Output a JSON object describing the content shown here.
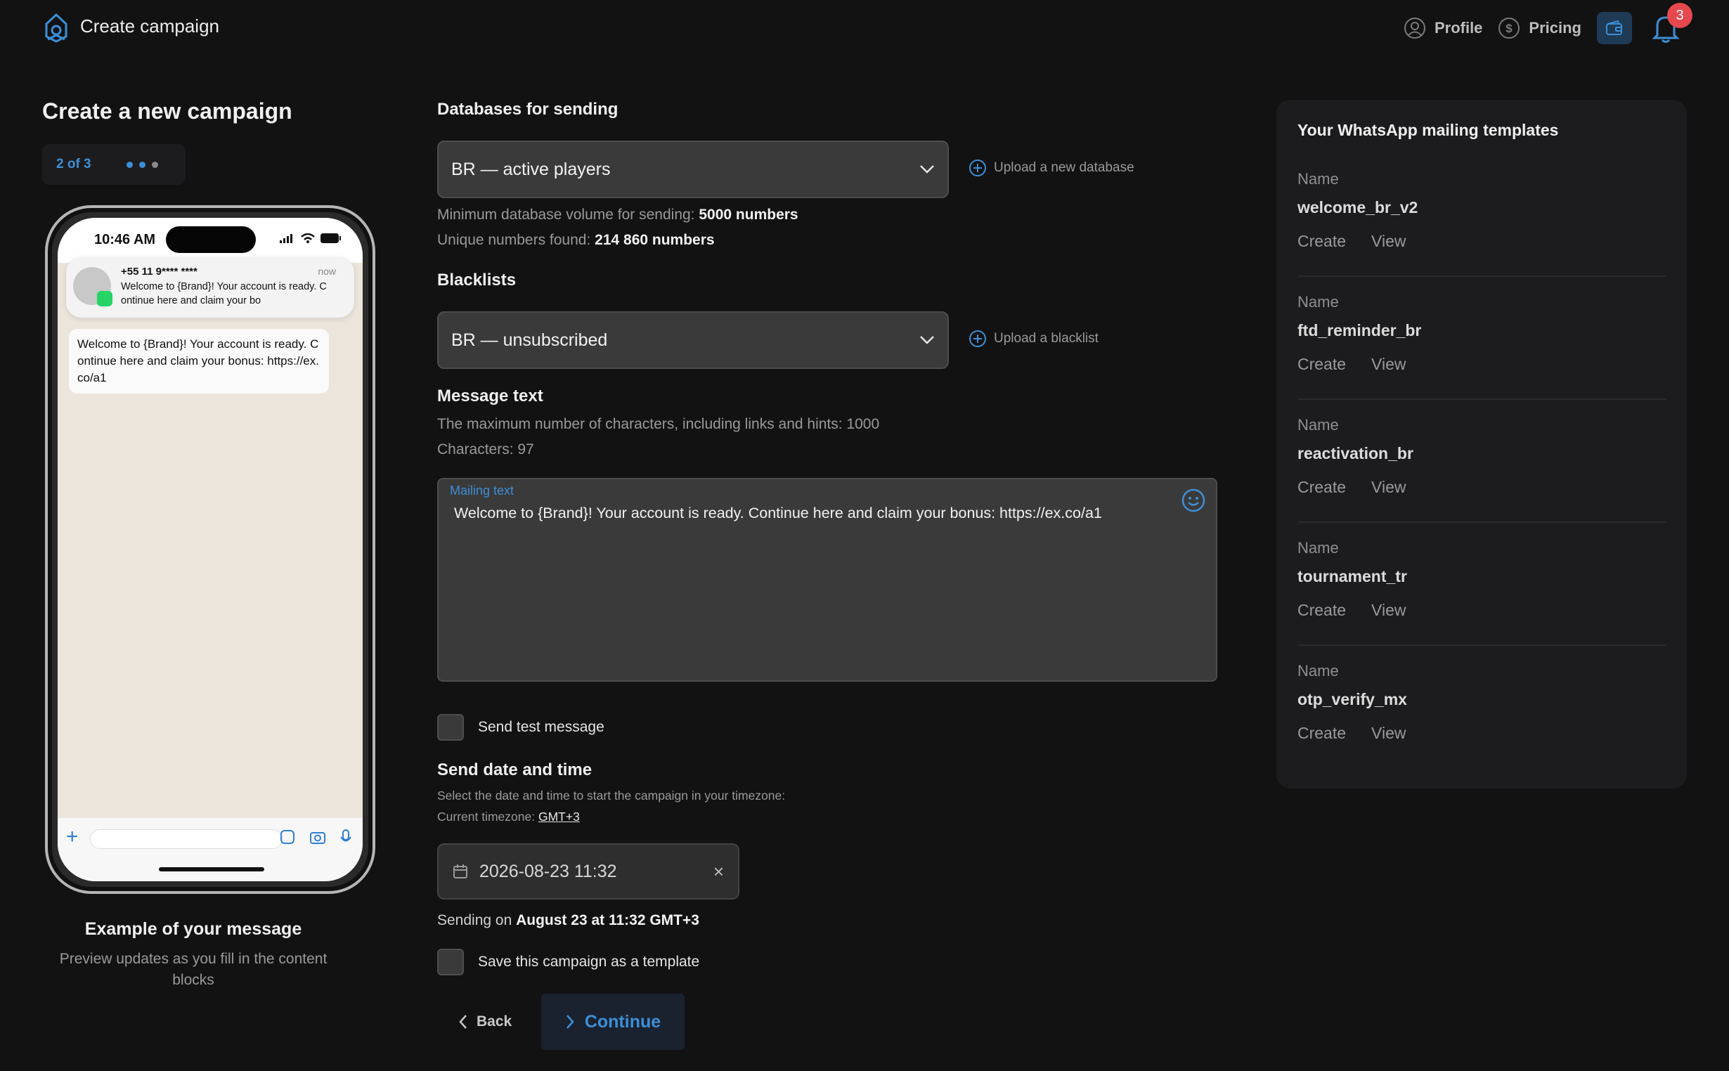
{
  "header": {
    "title": "Create campaign",
    "nav": {
      "profile": "Profile",
      "pricing": "Pricing"
    },
    "notifications_count": "3",
    "accent_color": "#3d8fd6"
  },
  "left": {
    "page_title": "Create a new campaign",
    "step": "2 of 3",
    "phone": {
      "time": "10:46 AM",
      "notification": {
        "sender": "+55 11 9**** ****",
        "time": "now",
        "body": "Welcome to {Brand}! Your account is ready. Continue here and claim your bo"
      },
      "bubble": "Welcome to {Brand}! Your account is ready. Continue here and claim your bonus: https://ex.co/a1"
    },
    "example_title": "Example of your message",
    "example_sub": "Preview updates as you fill in the content blocks"
  },
  "main": {
    "databases": {
      "title": "Databases for sending",
      "selected": "BR — active players",
      "upload_label": "Upload a new database",
      "min_volume_label": "Minimum database volume for sending:",
      "min_volume_value": "5000 numbers",
      "unique_label": "Unique numbers found:",
      "unique_value": "214 860 numbers"
    },
    "blacklists": {
      "title": "Blacklists",
      "selected": "BR — unsubscribed",
      "upload_label": "Upload a blacklist"
    },
    "message": {
      "title": "Message text",
      "max_info": "The maximum number of characters, including links and hints: 1000",
      "characters": "Characters: 97",
      "field_label": "Mailing text",
      "value": "Welcome to {Brand}! Your account is ready. Continue here and claim your bonus: https://ex.co/a1"
    },
    "send_test_label": "Send test message",
    "schedule": {
      "title": "Send date and time",
      "info": "Select the date and time to start the campaign in your timezone:",
      "timezone_label": "Current timezone:",
      "timezone_value": "GMT+3",
      "datetime": "2026-08-23 11:32",
      "sending_prefix": "Sending on",
      "sending_value": "August 23 at 11:32 GMT+3"
    },
    "save_template_label": "Save this campaign as a template",
    "back_label": "Back",
    "continue_label": "Continue"
  },
  "templates": {
    "title": "Your WhatsApp mailing templates",
    "name_label": "Name",
    "create_label": "Create",
    "view_label": "View",
    "items": [
      {
        "name": "welcome_br_v2"
      },
      {
        "name": "ftd_reminder_br"
      },
      {
        "name": "reactivation_br"
      },
      {
        "name": "tournament_tr"
      },
      {
        "name": "otp_verify_mx"
      }
    ]
  }
}
